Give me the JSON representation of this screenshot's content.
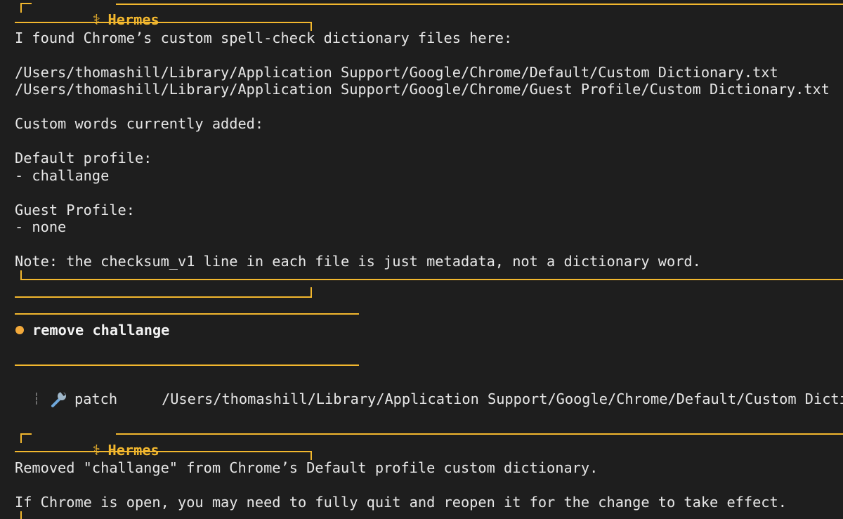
{
  "colors": {
    "background": "#1e1e1e",
    "text": "#e6e6e6",
    "accent": "#f2b72e",
    "bullet": "#f2a93b"
  },
  "panel1": {
    "title": "Hermes",
    "icon": "caduceus-icon",
    "lines": [
      "I found Chrome’s custom spell-check dictionary files here:",
      "/Users/thomashill/Library/Application Support/Google/Chrome/Default/Custom Dictionary.txt",
      "/Users/thomashill/Library/Application Support/Google/Chrome/Guest Profile/Custom Dictionary.txt",
      "Custom words currently added:",
      "Default profile:",
      "- challange",
      "Guest Profile:",
      "- none",
      "Note: the checksum_v1 line in each file is just metadata, not a dictionary word."
    ]
  },
  "user_message": {
    "text": "remove challange"
  },
  "tool_call": {
    "name": "patch",
    "icon": "wrench-icon",
    "path": "/Users/thomashill/Library/Application Support/Google/Chrome/Default/Custom Dicti"
  },
  "panel2": {
    "title": "Hermes",
    "icon": "caduceus-icon",
    "lines": [
      "Removed \"challange\" from Chrome’s Default profile custom dictionary.",
      "If Chrome is open, you may need to fully quit and reopen it for the change to take effect."
    ]
  }
}
